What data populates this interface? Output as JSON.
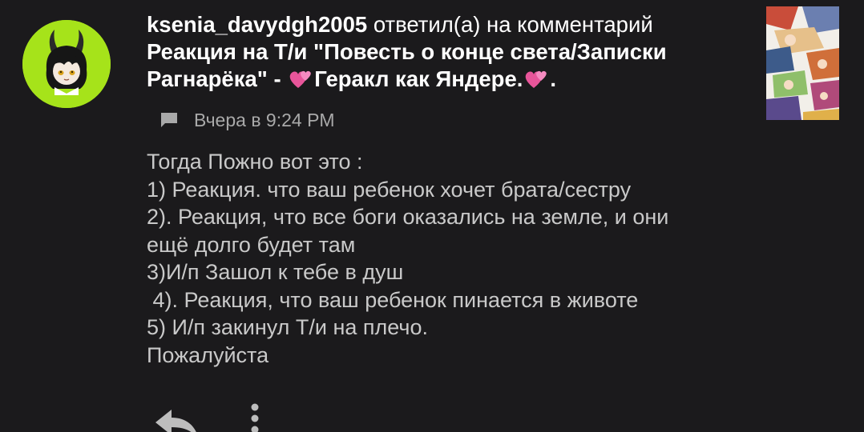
{
  "notification": {
    "username": "ksenia_davydgh2005",
    "action": "ответил(а) на комментарий",
    "post_title_part1": "Реакция на Т/и \"Повесть о конце света/Записки Рагнарёка\" -",
    "post_title_part2": "Геракл как Яндере.",
    "post_title_end": ".",
    "timestamp": "Вчера в 9:24 PM",
    "body_lines": [
      "Тогда Пожно вот это :",
      "1) Реакция. что ваш ребенок хочет брата/сестру",
      "2). Реакция, что все боги оказались на земле, и они",
      "ещё долго будет там",
      "3)И/п Зашол к тебе в душ",
      " 4). Реакция, что ваш ребенок пинается в животе",
      "5) И/п закинул Т/и на плечо.",
      "Пожалуйста"
    ]
  },
  "icons": {
    "heart": "two-hearts-emoji",
    "comment": "chat-bubble-icon",
    "reply": "reply-arrow-icon",
    "more": "more-vertical-icon"
  },
  "colors": {
    "background": "#1b1a1c",
    "avatar_bg": "#a6e31a",
    "text_primary": "#ffffff",
    "text_body": "#c9c9c9",
    "text_meta": "#a9a9a9",
    "heart": "#e8559a"
  }
}
